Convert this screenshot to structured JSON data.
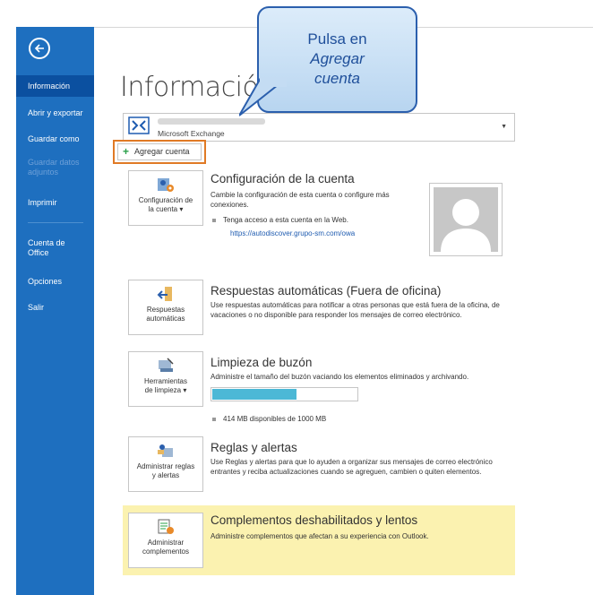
{
  "sidebar": {
    "back_icon": "back-arrow-icon",
    "items": [
      {
        "label": "Información",
        "active": true
      },
      {
        "label": "Abrir y exportar"
      },
      {
        "label": "Guardar como"
      },
      {
        "label": "Guardar datos adjuntos",
        "disabled": true
      },
      {
        "label": "Imprimir"
      },
      {
        "label": "Cuenta de Office"
      },
      {
        "label": "Opciones"
      },
      {
        "label": "Salir"
      }
    ],
    "color": "#1e6fbf"
  },
  "main": {
    "title": "Información",
    "account": {
      "type": "Microsoft Exchange",
      "icon": "exchange-icon"
    },
    "add_account_label": "Agregar cuenta",
    "sections": [
      {
        "tile_label": "Configuración de la cuenta ▾",
        "tile_icon": "account-settings-icon",
        "title": "Configuración de la cuenta",
        "desc": "Cambie la configuración de esta cuenta o configure más conexiones.",
        "bullet": "Tenga acceso a esta cuenta en la Web.",
        "link": "https://autodiscover.grupo-sm.com/owa"
      },
      {
        "tile_label": "Respuestas automáticas",
        "tile_icon": "auto-reply-icon",
        "title": "Respuestas automáticas (Fuera de oficina)",
        "desc": "Use respuestas automáticas para notificar a otras personas que está fuera de la oficina, de vacaciones o no disponible para responder los mensajes de correo electrónico."
      },
      {
        "tile_label": "Herramientas de limpieza ▾",
        "tile_icon": "cleanup-tools-icon",
        "title": "Limpieza de buzón",
        "desc": "Administre el tamaño del buzón vaciando los elementos eliminados y archivando.",
        "quota_text": "414 MB disponibles de 1000 MB",
        "quota_fraction": 0.586
      },
      {
        "tile_label": "Administrar reglas y alertas",
        "tile_icon": "rules-alerts-icon",
        "title": "Reglas y alertas",
        "desc": "Use Reglas y alertas para que lo ayuden a organizar sus mensajes de correo electrónico entrantes y reciba actualizaciones cuando se agreguen, cambien o quiten elementos."
      },
      {
        "tile_label": "Administrar complementos",
        "tile_icon": "addins-icon",
        "title": "Complementos deshabilitados y lentos",
        "desc": "Administre complementos que afectan a su experiencia con Outlook.",
        "highlight": "#fbf2b0"
      }
    ]
  },
  "callout": {
    "line1": "Pulsa en",
    "line2": "Agregar",
    "line3": "cuenta"
  },
  "colors": {
    "accent_orange": "#e07a25",
    "callout_border": "#2b5fad",
    "link": "#1e5bb0"
  }
}
